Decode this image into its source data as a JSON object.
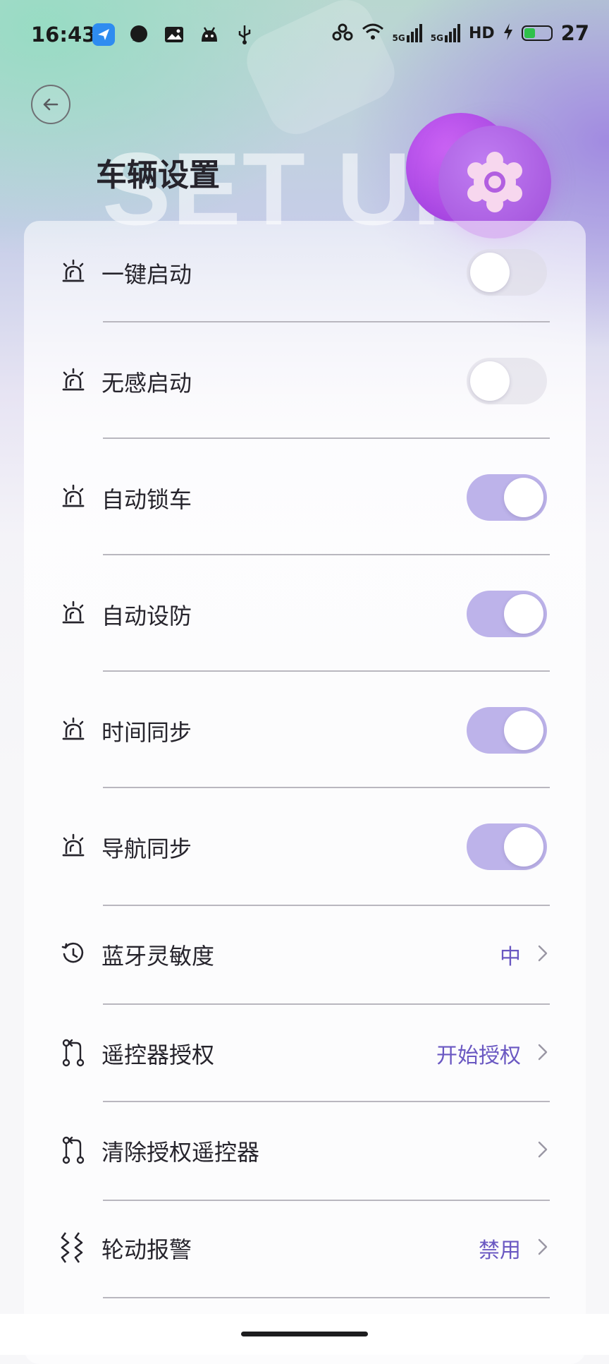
{
  "status_bar": {
    "time": "16:43",
    "network_label_1": "5G",
    "network_label_2": "5G",
    "hd_label": "HD",
    "battery_level": 27,
    "battery_text": "27"
  },
  "header": {
    "title": "车辆设置",
    "watermark": "SET UP"
  },
  "settings": [
    {
      "label": "一键启动",
      "icon": "siren-icon",
      "type": "toggle",
      "on": false
    },
    {
      "label": "无感启动",
      "icon": "siren-icon",
      "type": "toggle",
      "on": false
    },
    {
      "label": "自动锁车",
      "icon": "siren-icon",
      "type": "toggle",
      "on": true
    },
    {
      "label": "自动设防",
      "icon": "siren-icon",
      "type": "toggle",
      "on": true
    },
    {
      "label": "时间同步",
      "icon": "siren-icon",
      "type": "toggle",
      "on": true
    },
    {
      "label": "导航同步",
      "icon": "siren-icon",
      "type": "toggle",
      "on": true
    },
    {
      "label": "蓝牙灵敏度",
      "icon": "history-icon",
      "type": "link",
      "value": "中"
    },
    {
      "label": "遥控器授权",
      "icon": "pair-icon",
      "type": "link",
      "value": "开始授权"
    },
    {
      "label": "清除授权遥控器",
      "icon": "pair-icon",
      "type": "link",
      "value": ""
    },
    {
      "label": "轮动报警",
      "icon": "vibration-icon",
      "type": "link",
      "value": "禁用"
    }
  ],
  "colors": {
    "accent": "#6a58c2",
    "toggle_on": "#bdb3ea",
    "gear_orb": "#a04ed9"
  }
}
